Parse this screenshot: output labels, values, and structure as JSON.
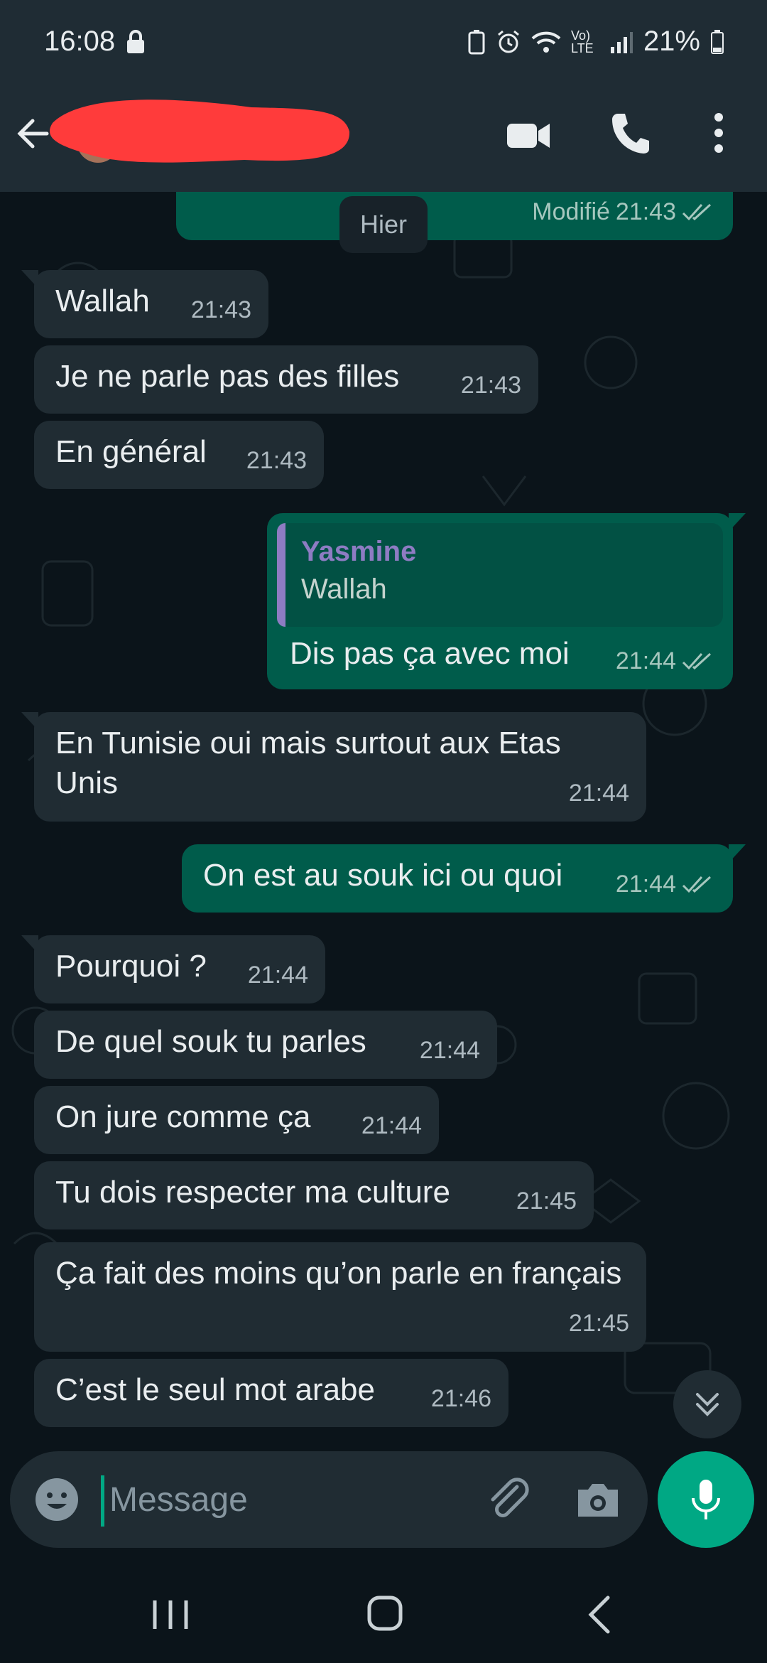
{
  "status_bar": {
    "time": "16:08",
    "battery": "21%",
    "network": "Vo) LTE"
  },
  "header": {
    "contact_name_redacted": true
  },
  "chat": {
    "date_chip": "Hier",
    "partial_message": {
      "edited_label": "Modifié",
      "time": "21:43"
    },
    "messages": [
      {
        "dir": "in",
        "text": "Wallah",
        "time": "21:43"
      },
      {
        "dir": "in",
        "text": "Je ne parle pas des filles",
        "time": "21:43"
      },
      {
        "dir": "in",
        "text": "En général",
        "time": "21:43"
      },
      {
        "dir": "out",
        "quote_author": "Yasmine",
        "quote_text": "Wallah",
        "text": "Dis pas ça avec moi",
        "time": "21:44"
      },
      {
        "dir": "in",
        "text": "En Tunisie oui mais surtout aux Etas Unis",
        "time": "21:44"
      },
      {
        "dir": "out",
        "text": "On est au souk ici ou quoi",
        "time": "21:44"
      },
      {
        "dir": "in",
        "text": "Pourquoi ?",
        "time": "21:44"
      },
      {
        "dir": "in",
        "text": "De quel souk tu parles",
        "time": "21:44"
      },
      {
        "dir": "in",
        "text": "On jure comme ça",
        "time": "21:44"
      },
      {
        "dir": "in",
        "text": "Tu dois respecter ma culture",
        "time": "21:45"
      },
      {
        "dir": "in",
        "text": "Ça fait des moins qu’on parle en français",
        "time": "21:45"
      },
      {
        "dir": "in",
        "text": "C’est le seul mot arabe",
        "time": "21:46"
      }
    ]
  },
  "composer": {
    "placeholder": "Message"
  },
  "colors": {
    "bg": "#0b141a",
    "header": "#1f2c34",
    "incoming": "#202c33",
    "outgoing": "#005c4b",
    "accent": "#00a884",
    "quote_author": "#8e7cc3",
    "redaction": "#ff3b3b"
  },
  "icons": [
    "back-arrow-icon",
    "video-call-icon",
    "phone-icon",
    "more-options-icon",
    "emoji-icon",
    "attachment-icon",
    "camera-icon",
    "microphone-icon",
    "scroll-down-icon",
    "double-check-icon",
    "lock-icon",
    "wifi-icon",
    "signal-icon",
    "battery-icon",
    "alarm-icon"
  ]
}
